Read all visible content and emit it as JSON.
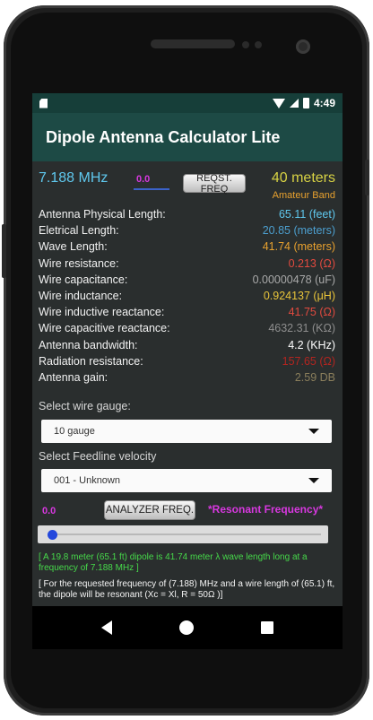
{
  "status": {
    "time": "4:49",
    "icons": [
      "sd-card-icon",
      "wifi-icon",
      "signal-icon",
      "battery-icon"
    ]
  },
  "appbar": {
    "title": "Dipole Antenna Calculator Lite"
  },
  "top": {
    "frequency": "7.188 MHz",
    "small_value": "0.0",
    "request_button": "REQST. FREQ",
    "band": "40 meters",
    "band_type": "Amateur Band"
  },
  "results": [
    {
      "label": "Antenna Physical Length:",
      "value": "65.11 (feet)",
      "color": "#5fc8ee"
    },
    {
      "label": "Eletrical Length:",
      "value": "20.85 (meters)",
      "color": "#4c9fcf"
    },
    {
      "label": "Wave Length:",
      "value": "41.74 (meters)",
      "color": "#e8a12e"
    },
    {
      "label": "Wire resistance:",
      "value": "0.213 (Ω)",
      "color": "#e24a3f"
    },
    {
      "label": "Wire capacitance:",
      "value": "0.00000478 (uF)",
      "color": "#a9a9a9"
    },
    {
      "label": "Wire inductance:",
      "value": "0.924137 (μH)",
      "color": "#e8c43a"
    },
    {
      "label": "Wire inductive reactance:",
      "value": "41.75 (Ω)",
      "color": "#e24a3f"
    },
    {
      "label": "Wire capacitive reactance:",
      "value": "4632.31 (KΩ)",
      "color": "#8e8e8e"
    },
    {
      "label": "Antenna bandwidth:",
      "value": "4.2 (KHz)",
      "color": "#ffffff"
    },
    {
      "label": "Radiation resistance:",
      "value": "157.65 (Ω)",
      "color": "#b32520"
    },
    {
      "label": "Antenna gain:",
      "value": "2.59 DB",
      "color": "#8b7f5c"
    }
  ],
  "gauge": {
    "label": "Select wire gauge:",
    "selected": "10 gauge"
  },
  "feedline": {
    "label": "Select Feedline velocity",
    "selected": "001 - Unknown"
  },
  "analyzer": {
    "value": "0.0",
    "button": "ANALYZER FREQ.",
    "resonant": "*Resonant Frequency*",
    "slider_level": 0.0
  },
  "notes": {
    "line1": "[ A 19.8 meter (65.1 ft) dipole is 41.74 meter λ  wave length  long at a frequency of 7.188 MHz ]",
    "line2": "[ For the requested frequency of (7.188) MHz and a wire length of (65.1) ft, the dipole will be resonant  (Xc = Xl,  R = 50Ω )]"
  },
  "colors": {
    "appbar": "#1d4a45",
    "statusbar": "#163e39",
    "screen_bg": "#2a2e2e",
    "accent_magenta": "#d838e0",
    "accent_green": "#46d94a"
  }
}
